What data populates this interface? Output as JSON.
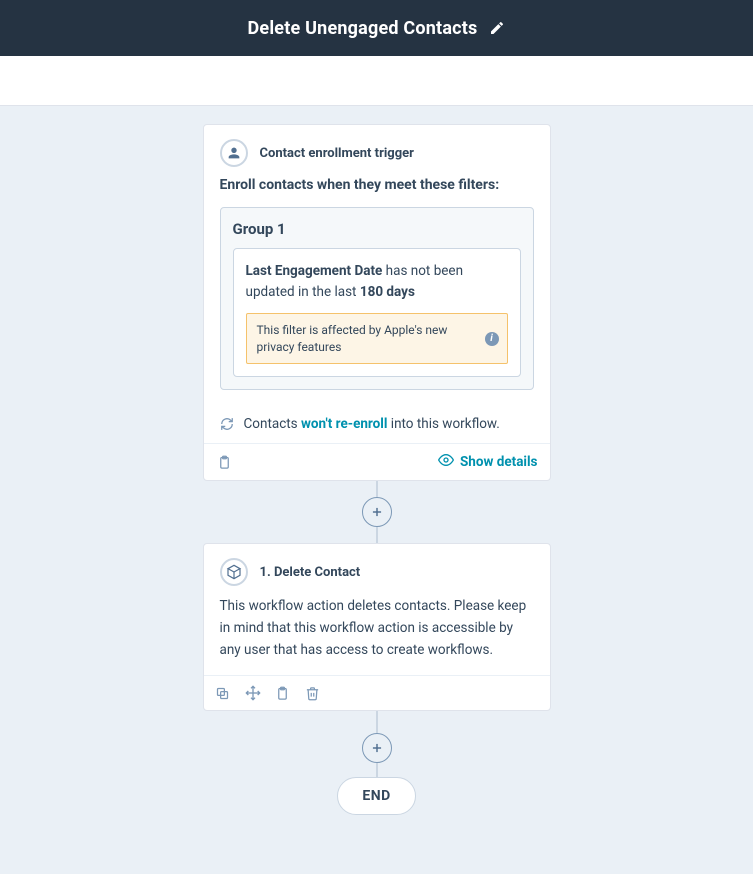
{
  "header": {
    "title": "Delete Unengaged Contacts"
  },
  "trigger": {
    "icon_label": "Contact enrollment trigger",
    "subhead": "Enroll contacts when they meet these filters:",
    "group_title": "Group 1",
    "filter_property": "Last Engagement Date",
    "filter_mid": " has not been updated in the last ",
    "filter_value": "180 days",
    "warning_text": "This filter is affected by Apple's new privacy features",
    "reenroll_prefix": "Contacts ",
    "reenroll_link": "won't re-enroll",
    "reenroll_suffix": " into this workflow.",
    "show_details": "Show details"
  },
  "action1": {
    "title": "1. Delete Contact",
    "description": "This workflow action deletes contacts. Please keep in mind that this workflow action is accessible by any user that has access to create workflows."
  },
  "end_label": "END"
}
